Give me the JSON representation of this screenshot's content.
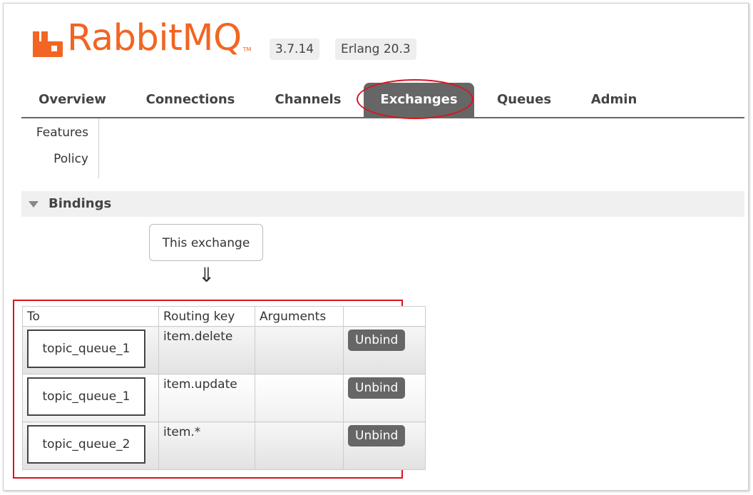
{
  "header": {
    "brand": "RabbitMQ",
    "tm": "TM",
    "version": "3.7.14",
    "erlang": "Erlang 20.3"
  },
  "tabs": [
    {
      "label": "Overview"
    },
    {
      "label": "Connections"
    },
    {
      "label": "Channels"
    },
    {
      "label": "Exchanges",
      "active": true
    },
    {
      "label": "Queues"
    },
    {
      "label": "Admin"
    }
  ],
  "subnav": [
    "Features",
    "Policy"
  ],
  "bindings": {
    "title": "Bindings",
    "source_label": "This exchange",
    "arrow": "⇓",
    "columns": [
      "To",
      "Routing key",
      "Arguments",
      ""
    ],
    "rows": [
      {
        "to": "topic_queue_1",
        "routing_key": "item.delete",
        "arguments": "",
        "action": "Unbind"
      },
      {
        "to": "topic_queue_1",
        "routing_key": "item.update",
        "arguments": "",
        "action": "Unbind"
      },
      {
        "to": "topic_queue_2",
        "routing_key": "item.*",
        "arguments": "",
        "action": "Unbind"
      }
    ]
  },
  "colors": {
    "brand": "#f26522",
    "tab_active": "#666666",
    "highlight": "#d9141e"
  }
}
